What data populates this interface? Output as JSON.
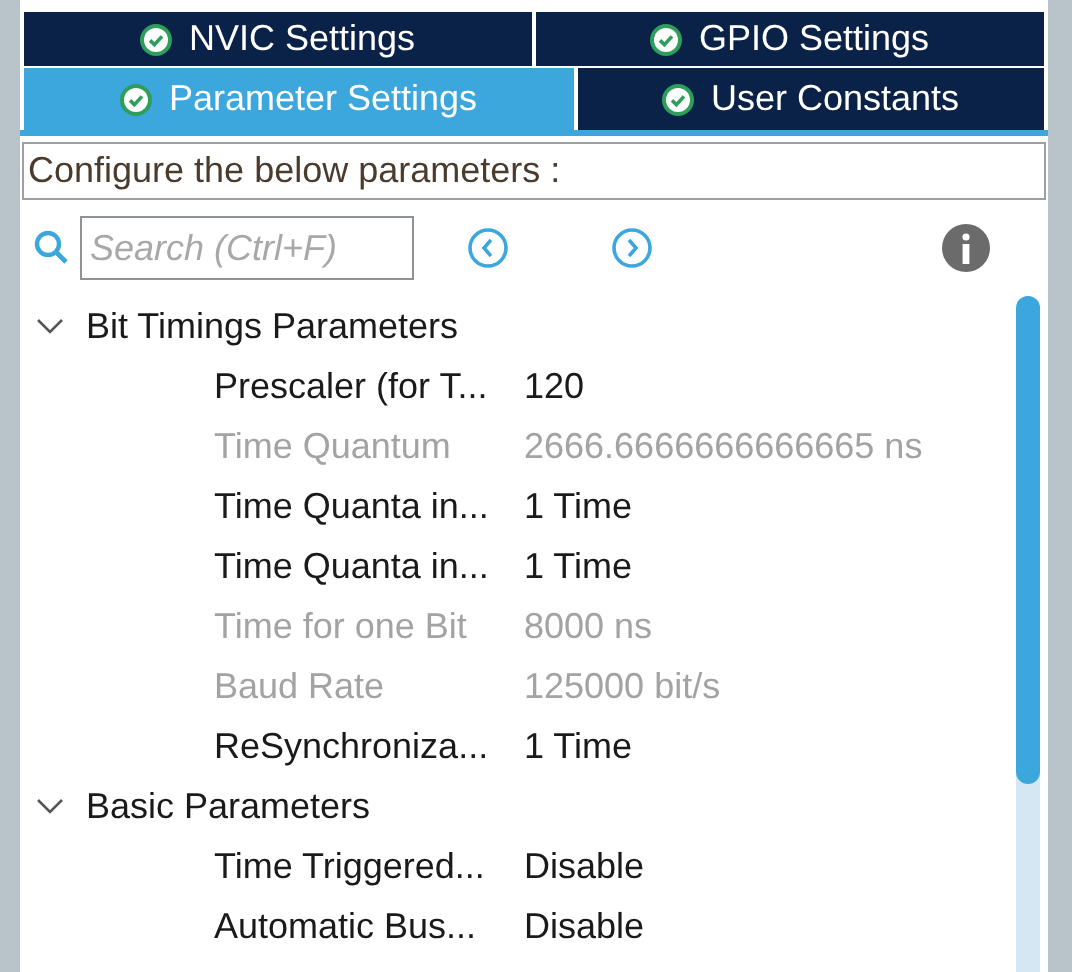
{
  "tab_rows": [
    [
      {
        "label": "NVIC Settings",
        "selected": false
      },
      {
        "label": "GPIO Settings",
        "selected": false
      }
    ],
    [
      {
        "label": "Parameter Settings",
        "selected": true
      },
      {
        "label": "User Constants",
        "selected": false
      }
    ]
  ],
  "description": "Configure the below parameters :",
  "search": {
    "placeholder": "Search (Ctrl+F)"
  },
  "groups": [
    {
      "title": "Bit Timings Parameters",
      "expanded": true,
      "params": [
        {
          "name": "Prescaler (for T...",
          "value": "120",
          "disabled": false
        },
        {
          "name": "Time Quantum",
          "value": "2666.6666666666665 ns",
          "disabled": true
        },
        {
          "name": "Time Quanta in...",
          "value": "1 Time",
          "disabled": false
        },
        {
          "name": "Time Quanta in...",
          "value": "1 Time",
          "disabled": false
        },
        {
          "name": "Time for one Bit",
          "value": "8000 ns",
          "disabled": true
        },
        {
          "name": "Baud Rate",
          "value": "125000 bit/s",
          "disabled": true
        },
        {
          "name": "ReSynchroniza...",
          "value": "1 Time",
          "disabled": false
        }
      ]
    },
    {
      "title": "Basic Parameters",
      "expanded": true,
      "params": [
        {
          "name": "Time Triggered...",
          "value": "Disable",
          "disabled": false
        },
        {
          "name": "Automatic Bus...",
          "value": "Disable",
          "disabled": false
        }
      ]
    }
  ]
}
